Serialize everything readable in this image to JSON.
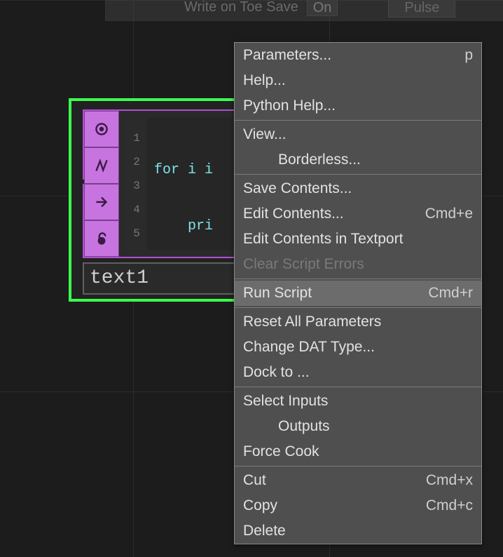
{
  "top_bar": {
    "label": "Write on Toe Save",
    "toggle_value": "On",
    "pulse_label": "Pulse"
  },
  "node": {
    "name": "text1",
    "line_numbers": [
      "1",
      "2",
      "3",
      "4",
      "5"
    ],
    "code_lines": [
      "for i i",
      "    pri",
      "",
      "",
      ""
    ]
  },
  "menu": {
    "items": [
      {
        "label": "Parameters...",
        "shortcut": "p"
      },
      {
        "label": "Help..."
      },
      {
        "label": "Python Help..."
      },
      {
        "sep": true
      },
      {
        "label": "View..."
      },
      {
        "label": "Borderless...",
        "sub": true
      },
      {
        "sep": true
      },
      {
        "label": "Save Contents..."
      },
      {
        "label": "Edit Contents...",
        "shortcut": "Cmd+e"
      },
      {
        "label": "Edit Contents in Textport"
      },
      {
        "label": "Clear Script Errors",
        "disabled": true
      },
      {
        "sep": true
      },
      {
        "label": "Run Script",
        "shortcut": "Cmd+r",
        "highlight": true
      },
      {
        "sep": true
      },
      {
        "label": "Reset All Parameters"
      },
      {
        "label": "Change DAT Type..."
      },
      {
        "label": "Dock to ..."
      },
      {
        "sep": true
      },
      {
        "label": "Select Inputs"
      },
      {
        "label": "Outputs",
        "sub": true
      },
      {
        "label": "Force Cook"
      },
      {
        "sep": true
      },
      {
        "label": "Cut",
        "shortcut": "Cmd+x"
      },
      {
        "label": "Copy",
        "shortcut": "Cmd+c"
      },
      {
        "label": "Delete"
      }
    ]
  }
}
